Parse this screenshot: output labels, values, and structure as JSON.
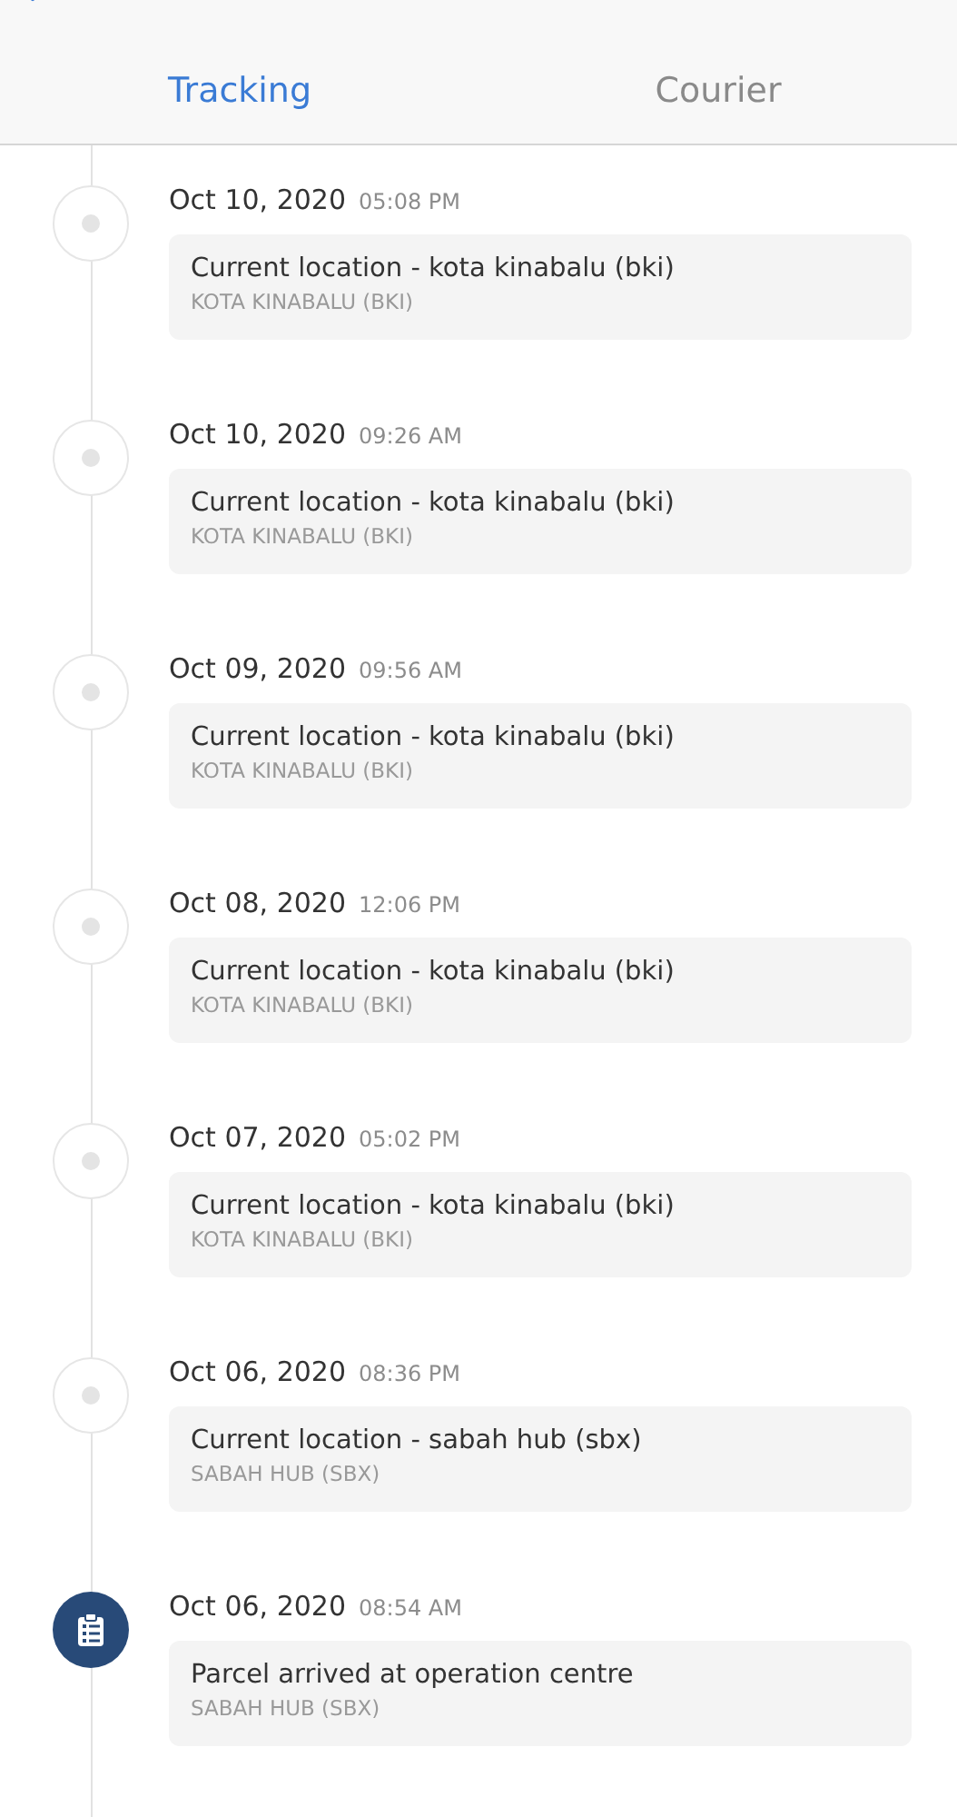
{
  "tabs": [
    {
      "label": "Tracking",
      "selected": true
    },
    {
      "label": "Courier",
      "selected": false
    }
  ],
  "events": [
    {
      "kind": "dot",
      "date": "Oct 10, 2020",
      "time": "05:08 PM",
      "title": "Current location - kota kinabalu (bki)",
      "location": "KOTA KINABALU (BKI)"
    },
    {
      "kind": "dot",
      "date": "Oct 10, 2020",
      "time": "09:26 AM",
      "title": "Current location - kota kinabalu (bki)",
      "location": "KOTA KINABALU (BKI)"
    },
    {
      "kind": "dot",
      "date": "Oct 09, 2020",
      "time": "09:56 AM",
      "title": "Current location - kota kinabalu (bki)",
      "location": "KOTA KINABALU (BKI)"
    },
    {
      "kind": "dot",
      "date": "Oct 08, 2020",
      "time": "12:06 PM",
      "title": "Current location - kota kinabalu (bki)",
      "location": "KOTA KINABALU (BKI)"
    },
    {
      "kind": "dot",
      "date": "Oct 07, 2020",
      "time": "05:02 PM",
      "title": "Current location - kota kinabalu (bki)",
      "location": "KOTA KINABALU (BKI)"
    },
    {
      "kind": "dot",
      "date": "Oct 06, 2020",
      "time": "08:36 PM",
      "title": "Current location - sabah hub (sbx)",
      "location": "SABAH HUB (SBX)"
    },
    {
      "kind": "clipboard",
      "date": "Oct 06, 2020",
      "time": "08:54 AM",
      "title": "Parcel arrived at operation centre",
      "location": "SABAH HUB (SBX)"
    }
  ]
}
